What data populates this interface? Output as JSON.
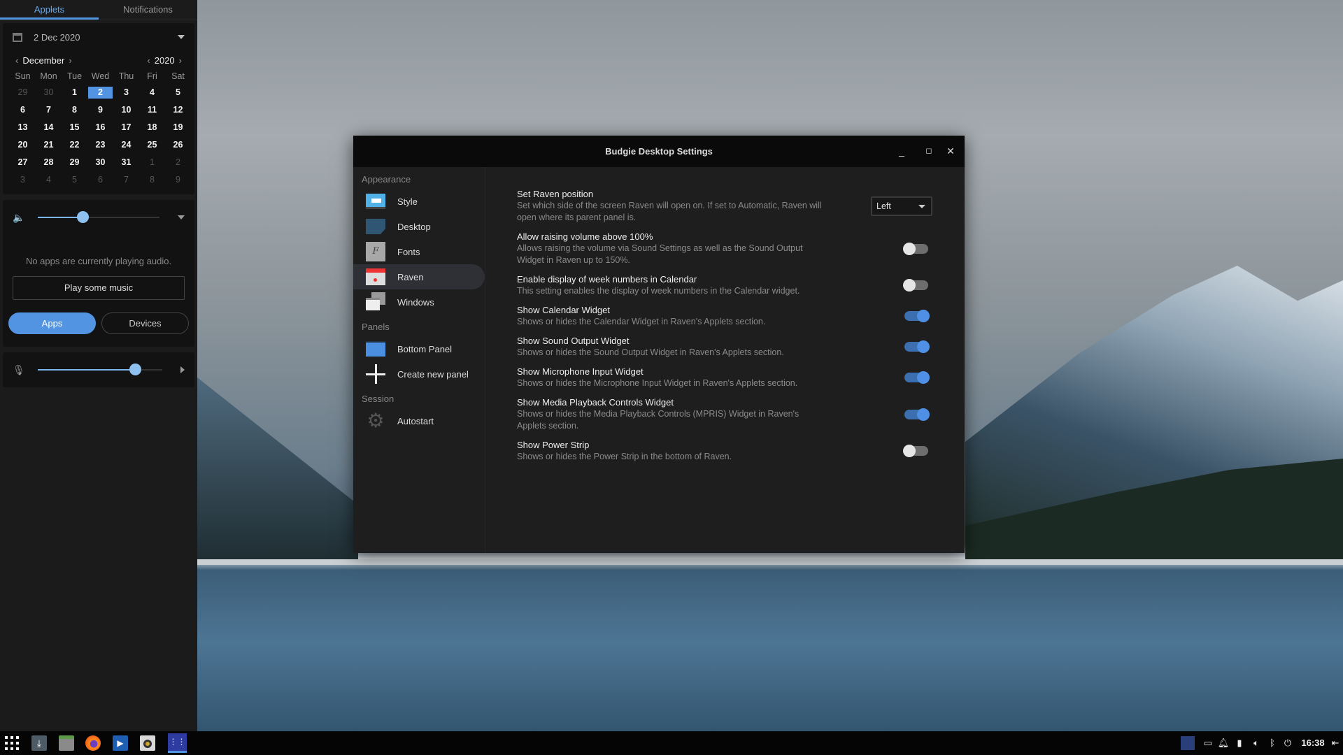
{
  "raven": {
    "tabs": [
      {
        "label": "Applets",
        "active": true
      },
      {
        "label": "Notifications",
        "active": false
      }
    ],
    "date_header": "2 Dec 2020",
    "month": "December",
    "year": "2020",
    "weekdays": [
      "Sun",
      "Mon",
      "Tue",
      "Wed",
      "Thu",
      "Fri",
      "Sat"
    ],
    "days": [
      [
        "29",
        "30",
        "1",
        "2",
        "3",
        "4",
        "5"
      ],
      [
        "6",
        "7",
        "8",
        "9",
        "10",
        "11",
        "12"
      ],
      [
        "13",
        "14",
        "15",
        "16",
        "17",
        "18",
        "19"
      ],
      [
        "20",
        "21",
        "22",
        "23",
        "24",
        "25",
        "26"
      ],
      [
        "27",
        "28",
        "29",
        "30",
        "31",
        "1",
        "2"
      ],
      [
        "3",
        "4",
        "5",
        "6",
        "7",
        "8",
        "9"
      ]
    ],
    "selected_day": "2",
    "sound_output_level": 0.37,
    "no_apps_text": "No apps are currently playing audio.",
    "play_music_label": "Play some music",
    "apps_label": "Apps",
    "devices_label": "Devices",
    "mic_level": 0.78
  },
  "window": {
    "title": "Budgie Desktop Settings",
    "sidebar": [
      {
        "section": "Appearance",
        "items": [
          {
            "label": "Style",
            "icon": "style-icon"
          },
          {
            "label": "Desktop",
            "icon": "desktop-icon"
          },
          {
            "label": "Fonts",
            "icon": "fonts-icon"
          },
          {
            "label": "Raven",
            "icon": "calendar-icon",
            "selected": true
          },
          {
            "label": "Windows",
            "icon": "windows-icon"
          }
        ]
      },
      {
        "section": "Panels",
        "items": [
          {
            "label": "Bottom Panel",
            "icon": "panel-icon"
          },
          {
            "label": "Create new panel",
            "icon": "plus-icon"
          }
        ]
      },
      {
        "section": "Session",
        "items": [
          {
            "label": "Autostart",
            "icon": "gear-icon"
          }
        ]
      }
    ],
    "settings": [
      {
        "title": "Set Raven position",
        "desc": "Set which side of the screen Raven will open on. If set to Automatic, Raven will open where its parent panel is.",
        "control": "combo",
        "value": "Left"
      },
      {
        "title": "Allow raising volume above 100%",
        "desc": "Allows raising the volume via Sound Settings as well as the Sound Output Widget in Raven up to 150%.",
        "control": "switch",
        "value": false
      },
      {
        "title": "Enable display of week numbers in Calendar",
        "desc": "This setting enables the display of week numbers in the Calendar widget.",
        "control": "switch",
        "value": false
      },
      {
        "title": "Show Calendar Widget",
        "desc": "Shows or hides the Calendar Widget in Raven's Applets section.",
        "control": "switch",
        "value": true
      },
      {
        "title": "Show Sound Output Widget",
        "desc": "Shows or hides the Sound Output Widget in Raven's Applets section.",
        "control": "switch",
        "value": true
      },
      {
        "title": "Show Microphone Input Widget",
        "desc": "Shows or hides the Microphone Input Widget in Raven's Applets section.",
        "control": "switch",
        "value": true
      },
      {
        "title": "Show Media Playback Controls Widget",
        "desc": "Shows or hides the Media Playback Controls (MPRIS) Widget in Raven's Applets section.",
        "control": "switch",
        "value": true
      },
      {
        "title": "Show Power Strip",
        "desc": "Shows or hides the Power Strip in the bottom of Raven.",
        "control": "switch",
        "value": false
      }
    ]
  },
  "taskbar": {
    "launchers": [
      "app-grid-icon",
      "downloads-icon",
      "file-manager-icon",
      "firefox-icon",
      "video-player-icon",
      "speaker-icon",
      "budgie-settings-icon"
    ],
    "tray": [
      "workspace-icon",
      "display-icon",
      "bell-icon",
      "battery-icon",
      "volume-icon",
      "bluetooth-icon",
      "power-icon"
    ],
    "clock": "16:38"
  },
  "colors": {
    "accent": "#5294e2"
  }
}
